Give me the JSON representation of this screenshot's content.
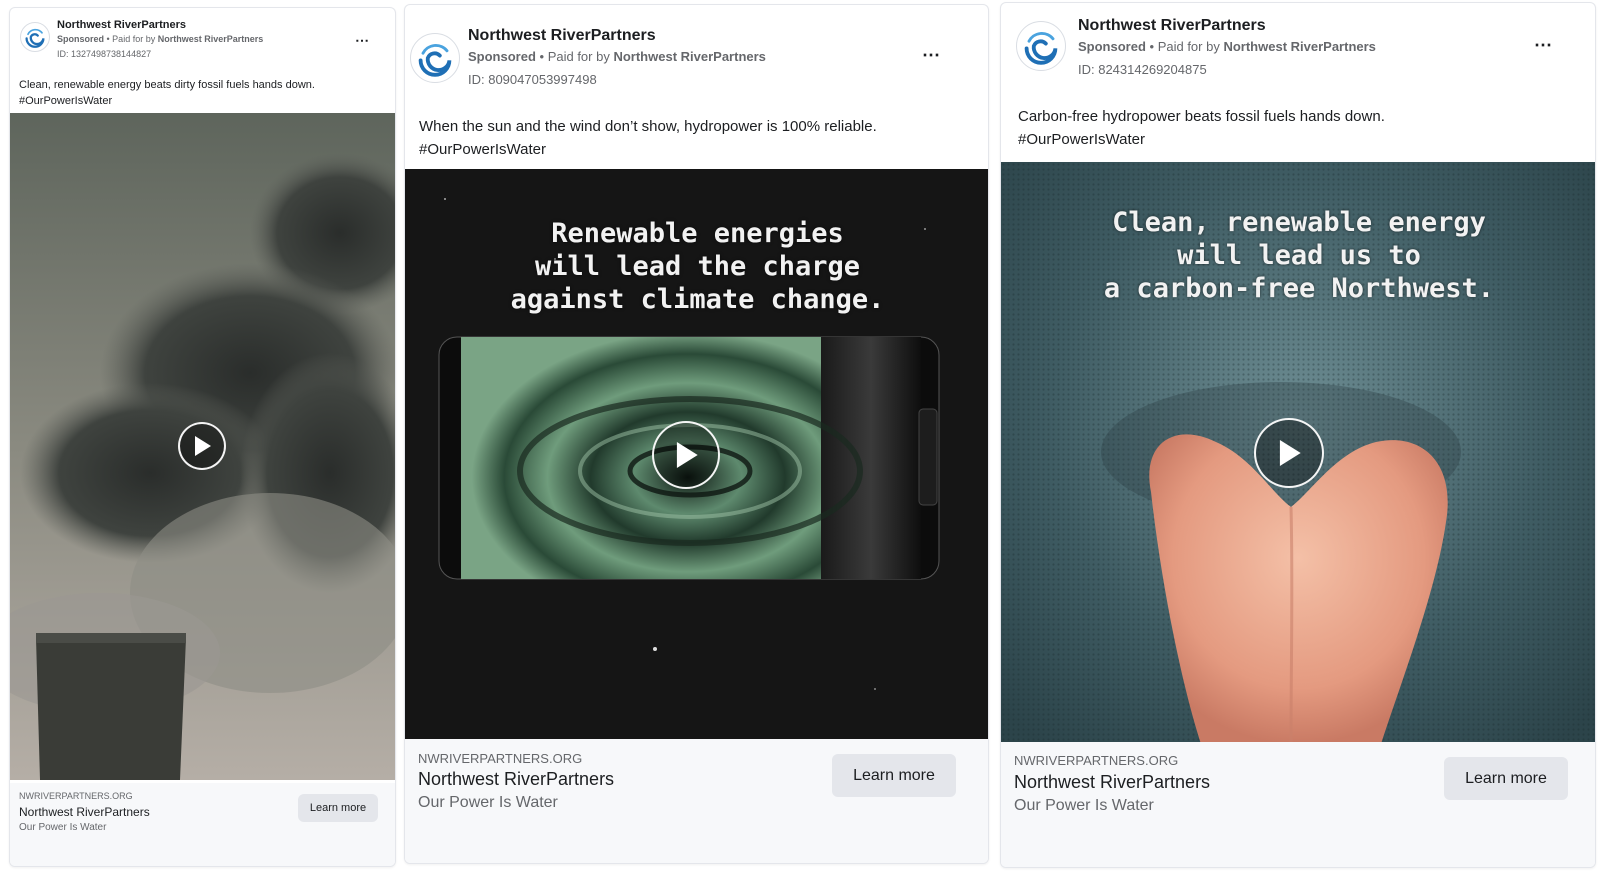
{
  "ads": [
    {
      "page_name": "Northwest RiverPartners",
      "sponsored_label": "Sponsored",
      "paid_for_prefix": "• Paid for by",
      "paid_for_by": "Northwest RiverPartners",
      "ad_id": "ID: 1327498738144827",
      "caption": "Clean, renewable energy beats dirty fossil fuels hands down.\n#OurPowerIsWater",
      "overlay_text": "",
      "domain": "NWRIVERPARTNERS.ORG",
      "link_title": "Northwest RiverPartners",
      "link_description": "Our Power Is Water",
      "cta_label": "Learn more",
      "more_icon": "⋯"
    },
    {
      "page_name": "Northwest RiverPartners",
      "sponsored_label": "Sponsored",
      "paid_for_prefix": "• Paid for by",
      "paid_for_by": "Northwest RiverPartners",
      "ad_id": "ID: 809047053997498",
      "caption": "When the sun and the wind don’t show, hydropower is 100% reliable.\n#OurPowerIsWater",
      "overlay_text": "Renewable energies\nwill lead the charge\nagainst climate change.",
      "domain": "NWRIVERPARTNERS.ORG",
      "link_title": "Northwest RiverPartners",
      "link_description": "Our Power Is Water",
      "cta_label": "Learn more",
      "more_icon": "⋯"
    },
    {
      "page_name": "Northwest RiverPartners",
      "sponsored_label": "Sponsored",
      "paid_for_prefix": "• Paid for by",
      "paid_for_by": "Northwest RiverPartners",
      "ad_id": "ID: 824314269204875",
      "caption": "Carbon-free hydropower beats fossil fuels hands down.\n#OurPowerIsWater",
      "overlay_text": "Clean, renewable energy\nwill lead us to\na carbon-free Northwest.",
      "domain": "NWRIVERPARTNERS.ORG",
      "link_title": "Northwest RiverPartners",
      "link_description": "Our Power Is Water",
      "cta_label": "Learn more",
      "more_icon": "⋯"
    }
  ],
  "icons": {
    "logo": "nwrp-swirl-logo-icon",
    "play": "play-icon",
    "more": "more-options-icon"
  },
  "colors": {
    "logo_blue": "#1f6fb5",
    "secondary_text": "#65676b",
    "cta_background": "#e4e6eb",
    "footer_background": "#f7f8fa"
  }
}
